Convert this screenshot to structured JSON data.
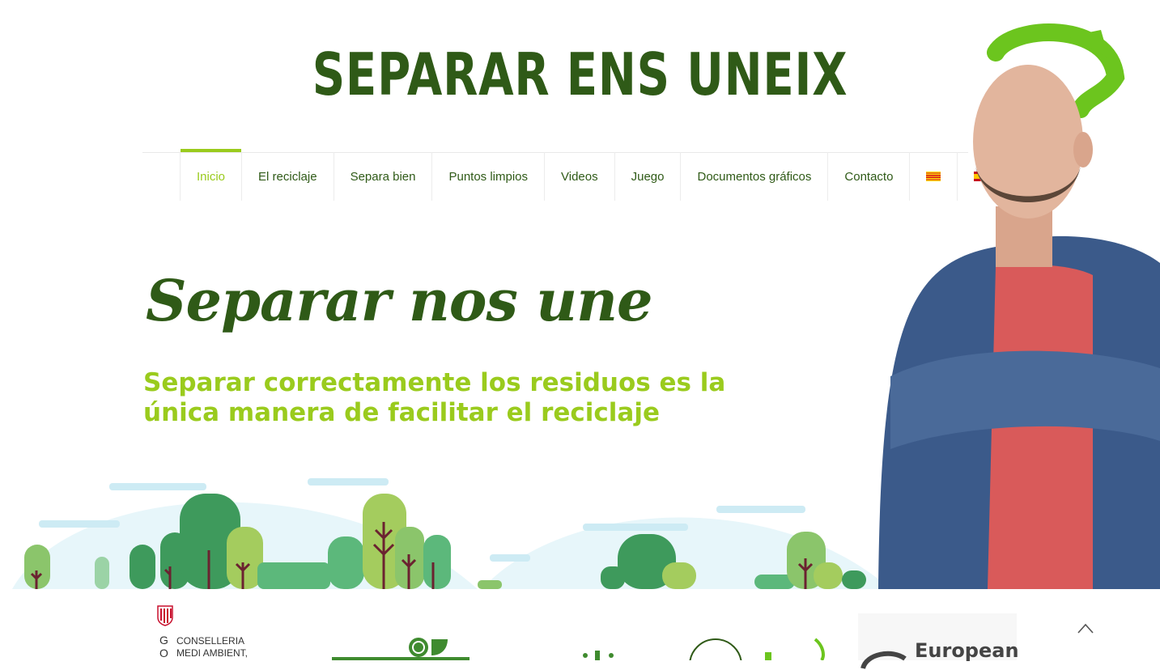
{
  "header": {
    "site_title": "SEPARAR ENS UNEIX"
  },
  "nav": {
    "items": [
      {
        "label": "Inicio",
        "active": true
      },
      {
        "label": "El reciclaje"
      },
      {
        "label": "Separa bien"
      },
      {
        "label": "Puntos limpios"
      },
      {
        "label": "Videos"
      },
      {
        "label": "Juego"
      },
      {
        "label": "Documentos gráficos"
      },
      {
        "label": "Contacto"
      }
    ],
    "flags": [
      "catalan-flag-icon",
      "spanish-flag-icon"
    ],
    "active_color": "#9acb1d",
    "text_color": "#2f5a17"
  },
  "hero": {
    "title": "Separar nos une",
    "subtitle": "Separar correctamente los residuos es la única manera de facilitar el reciclaje"
  },
  "footer": {
    "govt_letters": [
      "G",
      "O"
    ],
    "govt_lines": [
      "CONSELLERIA",
      "MEDI AMBIENT,"
    ],
    "eu_text": "European"
  },
  "colors": {
    "brand_dark": "#2f5a17",
    "brand_light": "#9acb1d"
  }
}
